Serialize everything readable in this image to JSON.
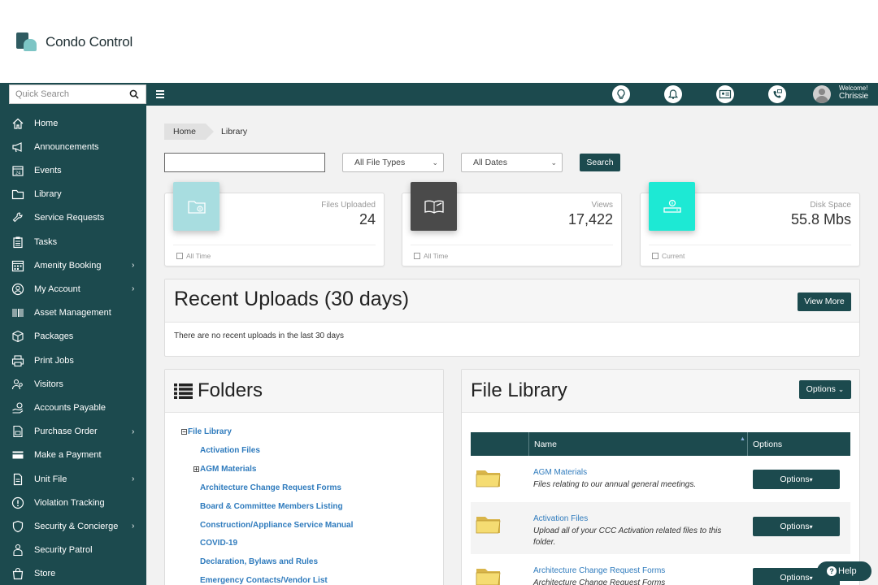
{
  "brand": {
    "name": "Condo Control"
  },
  "topbar": {
    "search_placeholder": "Quick Search",
    "welcome_label": "Welcome!",
    "user_name": "Chrissie",
    "icons": [
      "lightbulb-icon",
      "bell-icon",
      "id-card-icon",
      "phone-mail-icon"
    ]
  },
  "sidebar": {
    "items": [
      {
        "label": "Home",
        "icon": "home-icon",
        "submenu": false
      },
      {
        "label": "Announcements",
        "icon": "megaphone-icon",
        "submenu": false
      },
      {
        "label": "Events",
        "icon": "calendar-icon",
        "submenu": false
      },
      {
        "label": "Library",
        "icon": "folder-icon",
        "submenu": false
      },
      {
        "label": "Service Requests",
        "icon": "wrench-icon",
        "submenu": false
      },
      {
        "label": "Tasks",
        "icon": "clipboard-icon",
        "submenu": false
      },
      {
        "label": "Amenity Booking",
        "icon": "calendar-grid-icon",
        "submenu": true
      },
      {
        "label": "My Account",
        "icon": "user-circle-icon",
        "submenu": true
      },
      {
        "label": "Asset Management",
        "icon": "barcode-icon",
        "submenu": false
      },
      {
        "label": "Packages",
        "icon": "box-icon",
        "submenu": false
      },
      {
        "label": "Print Jobs",
        "icon": "printer-icon",
        "submenu": false
      },
      {
        "label": "Visitors",
        "icon": "visitors-icon",
        "submenu": false
      },
      {
        "label": "Accounts Payable",
        "icon": "hand-money-icon",
        "submenu": false
      },
      {
        "label": "Purchase Order",
        "icon": "document-po-icon",
        "submenu": true
      },
      {
        "label": "Make a Payment",
        "icon": "credit-card-icon",
        "submenu": false
      },
      {
        "label": "Unit File",
        "icon": "file-icon",
        "submenu": true
      },
      {
        "label": "Violation Tracking",
        "icon": "warning-circle-icon",
        "submenu": false
      },
      {
        "label": "Security & Concierge",
        "icon": "shield-icon",
        "submenu": true
      },
      {
        "label": "Security Patrol",
        "icon": "patrol-icon",
        "submenu": false
      },
      {
        "label": "Store",
        "icon": "bag-icon",
        "submenu": false
      }
    ]
  },
  "breadcrumb": {
    "home": "Home",
    "current": "Library"
  },
  "filters": {
    "search_value": "",
    "file_types": "All File Types",
    "dates": "All Dates",
    "search_button": "Search"
  },
  "stats": [
    {
      "label": "Files Uploaded",
      "value": "24",
      "footer": "All Time",
      "color": "#a8dde0",
      "icon": "folder-upload-icon"
    },
    {
      "label": "Views",
      "value": "17,422",
      "footer": "All Time",
      "color": "#4a4a4a",
      "icon": "open-book-icon"
    },
    {
      "label": "Disk Space",
      "value": "55.8 Mbs",
      "footer": "Current",
      "color": "#1de9d4",
      "icon": "hard-drive-icon"
    }
  ],
  "recent": {
    "title": "Recent Uploads (30 days)",
    "view_more": "View More",
    "empty_text": "There are no recent uploads in the last 30 days"
  },
  "folders": {
    "title": "Folders",
    "root": "File Library",
    "items": [
      {
        "label": "Activation Files",
        "toggle": ""
      },
      {
        "label": "AGM Materials",
        "toggle": "+"
      },
      {
        "label": "Architecture Change Request Forms",
        "toggle": ""
      },
      {
        "label": "Board & Committee Members Listing",
        "toggle": ""
      },
      {
        "label": "Construction/Appliance Service Manual",
        "toggle": ""
      },
      {
        "label": "COVID-19",
        "toggle": ""
      },
      {
        "label": "Declaration, Bylaws and Rules",
        "toggle": ""
      },
      {
        "label": "Emergency Contacts/Vendor List",
        "toggle": ""
      }
    ]
  },
  "file_library": {
    "title": "File Library",
    "options_label": "Options",
    "columns": {
      "name": "Name",
      "options": "Options"
    },
    "rows": [
      {
        "name": "AGM Materials",
        "desc": "Files relating to our annual general meetings.",
        "options": "Options"
      },
      {
        "name": "Activation Files",
        "desc": "Upload all of your CCC Activation related files to this folder.",
        "options": "Options"
      },
      {
        "name": "Architecture Change Request Forms",
        "desc": "Architecture Change Request Forms",
        "options": "Options"
      }
    ]
  },
  "help": {
    "label": "Help"
  },
  "colors": {
    "primary": "#1c4a4e",
    "link": "#2f7bbd"
  }
}
